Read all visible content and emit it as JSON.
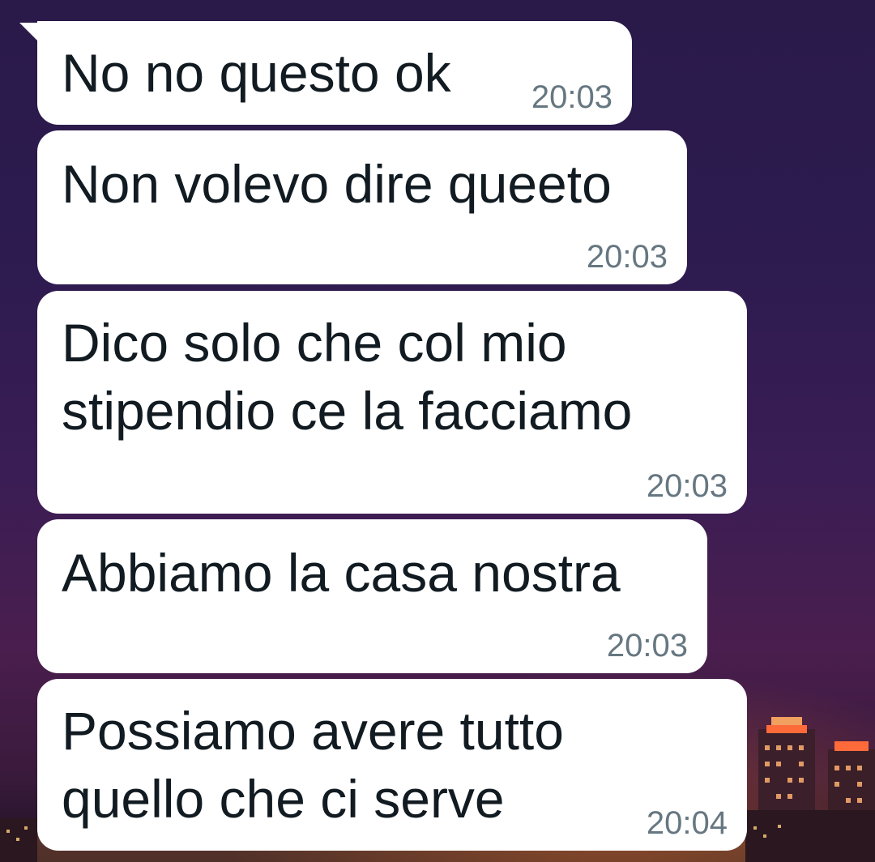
{
  "colors": {
    "bubble": "#ffffff",
    "text": "#111b21",
    "time": "#667781",
    "background": "#2d1b4f"
  },
  "messages": [
    {
      "text": "No no questo ok",
      "time": "20:03"
    },
    {
      "text": "Non volevo dire queeto",
      "time": "20:03"
    },
    {
      "text": "Dico solo che col mio\nstipendio ce la facciamo",
      "time": "20:03"
    },
    {
      "text": "Abbiamo la casa nostra",
      "time": "20:03"
    },
    {
      "text": "Possiamo avere tutto\nquello che ci serve",
      "time": "20:04"
    }
  ]
}
